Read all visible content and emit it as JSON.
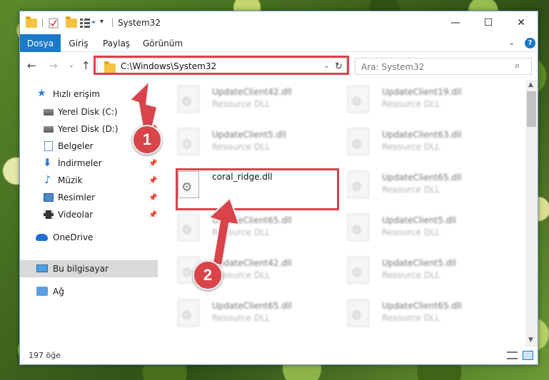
{
  "window": {
    "title": "System32",
    "minimize_icon": "—",
    "maximize_icon": "☐",
    "close_icon": "✕"
  },
  "quick_access_toolbar": {
    "dropdown_glyph": "▾"
  },
  "ribbon": {
    "tabs": [
      "Dosya",
      "Giriş",
      "Paylaş",
      "Görünüm"
    ],
    "active_tab": "Dosya",
    "accent_color": "#1979ca",
    "collapse_glyph": "⌄",
    "help_glyph": "?"
  },
  "navigation": {
    "back_glyph": "←",
    "forward_glyph": "→",
    "recent_glyph": "⌄",
    "up_glyph": "↑",
    "address": "C:\\Windows\\System32",
    "address_dropdown_glyph": "⌄",
    "refresh_glyph": "↻",
    "search_placeholder": "Ara: System32",
    "search_glyph": "⌕"
  },
  "sidebar": {
    "items": [
      {
        "label": "Hızlı erişim",
        "icon": "star-icon",
        "pinned": false
      },
      {
        "label": "Yerel Disk (C:)",
        "icon": "drive-icon",
        "pinned": true
      },
      {
        "label": "Yerel Disk (D:)",
        "icon": "drive-icon",
        "pinned": true
      },
      {
        "label": "Belgeler",
        "icon": "documents-icon",
        "pinned": true
      },
      {
        "label": "İndirmeler",
        "icon": "download-icon",
        "pinned": true
      },
      {
        "label": "Müzik",
        "icon": "music-icon",
        "pinned": true
      },
      {
        "label": "Resimler",
        "icon": "pictures-icon",
        "pinned": true
      },
      {
        "label": "Videolar",
        "icon": "video-icon",
        "pinned": true
      },
      {
        "label": "OneDrive",
        "icon": "cloud-icon",
        "pinned": false
      },
      {
        "label": "Bu bilgisayar",
        "icon": "computer-icon",
        "pinned": false,
        "selected": true
      },
      {
        "label": "Ağ",
        "icon": "network-icon",
        "pinned": false
      }
    ],
    "pin_glyph": "📌",
    "star_glyph": "★",
    "download_glyph": "⬇",
    "music_glyph": "♪"
  },
  "files": {
    "left_column": [
      {
        "name": "UpdateClient42.dll",
        "type": "Resource DLL"
      },
      {
        "name": "UpdateClient5.dll",
        "type": "Resource DLL"
      },
      {
        "name": "coral_ridge.dll",
        "type": ""
      },
      {
        "name": "UpdateClient65.dll",
        "type": "Resource DLL"
      },
      {
        "name": "UpdateClient42.dll",
        "type": "Resource DLL"
      },
      {
        "name": "UpdateClient65.dll",
        "type": "Resource DLL"
      }
    ],
    "right_column": [
      {
        "name": "UpdateClient19.dll",
        "type": "Resource DLL"
      },
      {
        "name": "UpdateClient63.dll",
        "type": "Resource DLL"
      },
      {
        "name": "UpdateClient65.dll",
        "type": "Resource DLL"
      },
      {
        "name": "UpdateClient5.dll",
        "type": "Resource DLL"
      },
      {
        "name": "UpdateClient5.dll",
        "type": "Resource DLL"
      },
      {
        "name": "UpdateClient65.dll",
        "type": "Resource DLL"
      }
    ]
  },
  "scrollbar": {
    "up_glyph": "▲",
    "down_glyph": "▼"
  },
  "status": {
    "item_count": "197 öğe"
  },
  "annotations": {
    "marker_1": "1",
    "marker_2": "2",
    "color": "#d9434a"
  }
}
